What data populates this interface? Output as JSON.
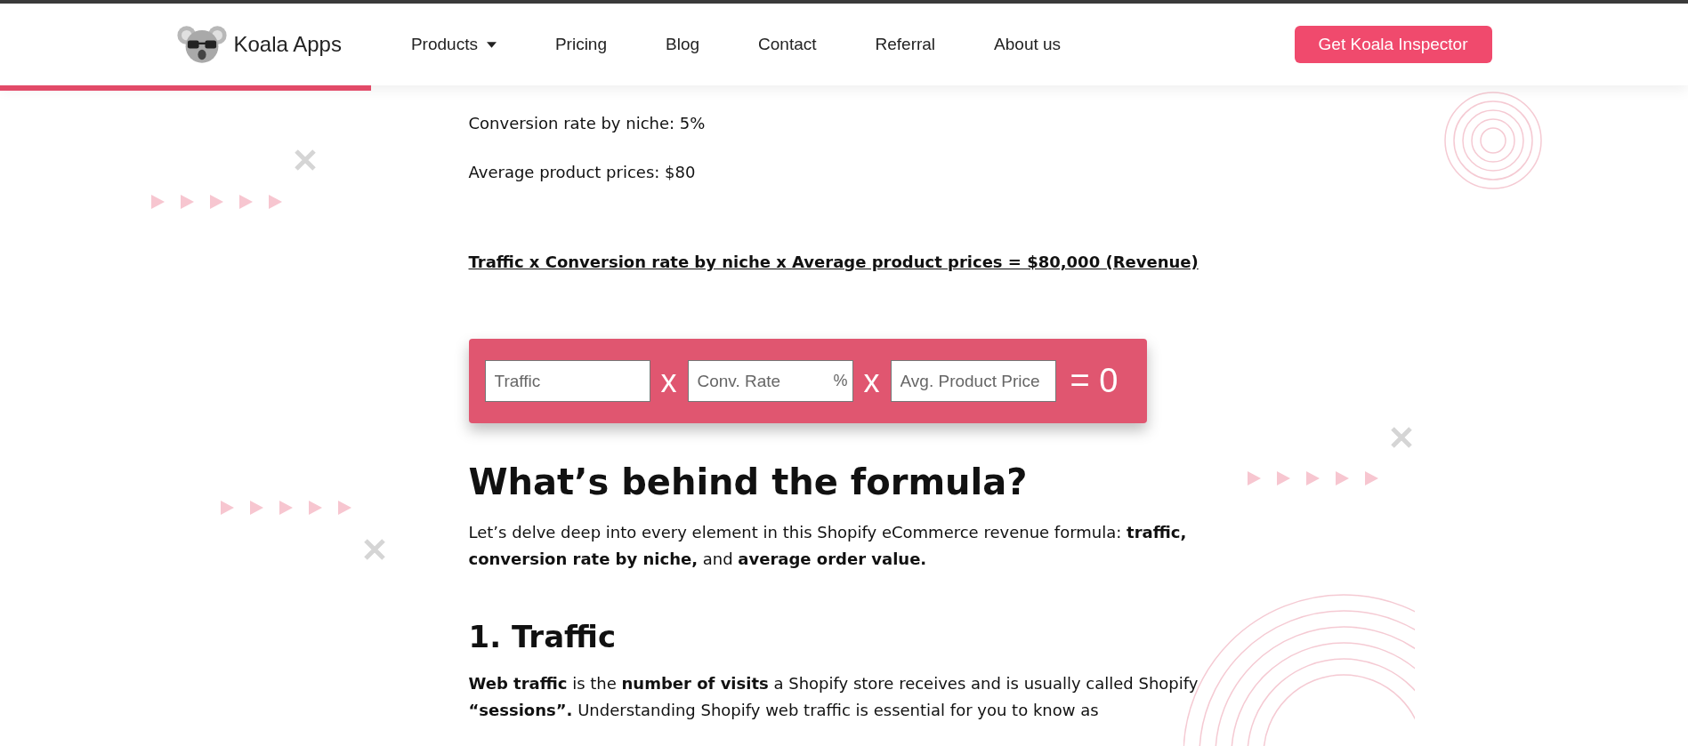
{
  "header": {
    "brand": "Koala Apps",
    "nav": [
      {
        "label": "Products",
        "dropdown": true
      },
      {
        "label": "Pricing",
        "dropdown": false
      },
      {
        "label": "Blog",
        "dropdown": false
      },
      {
        "label": "Contact",
        "dropdown": false
      },
      {
        "label": "Referral",
        "dropdown": false
      },
      {
        "label": "About us",
        "dropdown": false
      }
    ],
    "cta": "Get Koala Inspector",
    "reading_progress": {
      "level": 0.22
    }
  },
  "intro_lines": [
    "Conversion rate by niche: 5%",
    "Average product prices: $80"
  ],
  "formula": "Traffic x Conversion rate by niche x Average product prices = $80,000 (Revenue)",
  "calculator": {
    "items": [
      {
        "kind": "field",
        "placeholder": "Traffic"
      },
      {
        "kind": "operator",
        "text": "x"
      },
      {
        "kind": "field",
        "placeholder": "Conv. Rate",
        "suffix": "%"
      },
      {
        "kind": "operator",
        "text": "x"
      },
      {
        "kind": "field",
        "placeholder": "Avg. Product Price"
      },
      {
        "kind": "result",
        "text": "= 0"
      }
    ]
  },
  "heading": "What’s behind the formula?",
  "heading_paragraph": "Let’s delve deep into every element in this Shopify eCommerce revenue formula: **traffic, conversion rate by niche,** and **average order value.**",
  "section_heading": "1. Traffic",
  "section_paragraph": "**Web traffic** is the **number of visits** a Shopify store receives and is usually called Shopify **“sessions”.** Understanding Shopify web traffic is essential for you to know as"
}
